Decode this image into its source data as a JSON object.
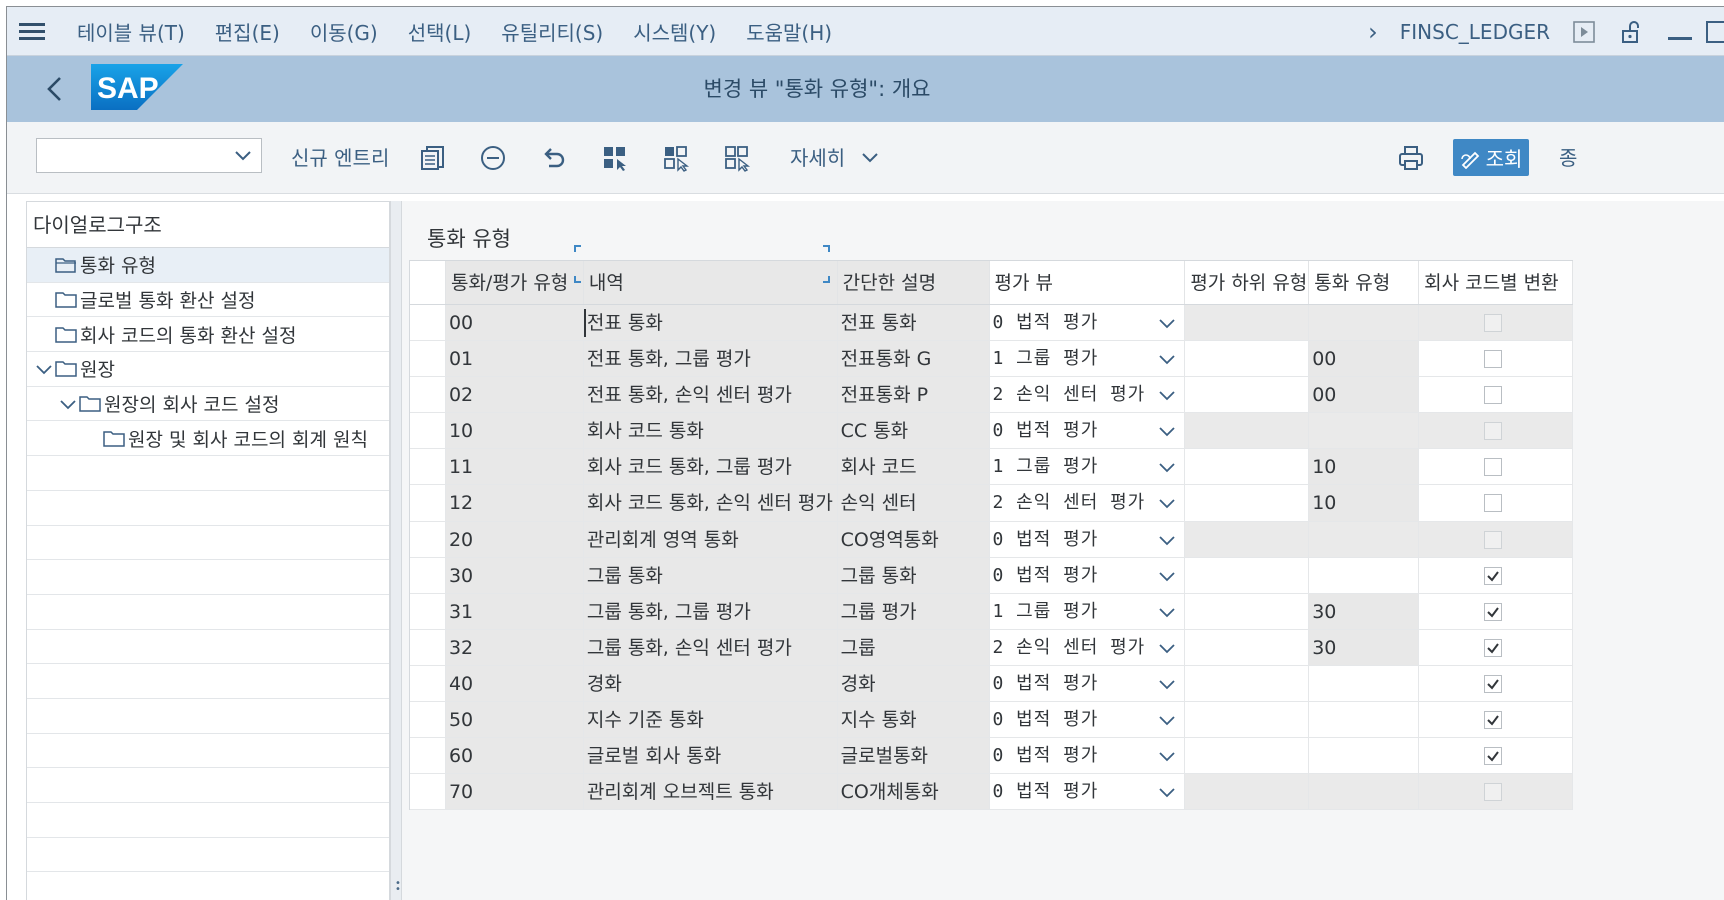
{
  "menubar": {
    "items": [
      "테이블 뷰(T)",
      "편집(E)",
      "이동(G)",
      "선택(L)",
      "유틸리티(S)",
      "시스템(Y)",
      "도움말(H)"
    ],
    "system_name": "FINSC_LEDGER"
  },
  "titlebar": {
    "title": "변경 뷰 \"통화 유형\": 개요",
    "logo_text": "SAP"
  },
  "toolbar": {
    "command_field_value": "",
    "new_entries_label": "신규 엔트리",
    "details_label": "자세히",
    "display_label": "조회",
    "cut_off_label": "종"
  },
  "left_panel": {
    "header": "다이얼로그구조",
    "items": [
      {
        "label": "통화 유형",
        "indent": 0,
        "expanded": null,
        "selected": true
      },
      {
        "label": "글로벌 통화 환산 설정",
        "indent": 0,
        "expanded": null,
        "selected": false
      },
      {
        "label": "회사 코드의 통화 환산 설정",
        "indent": 0,
        "expanded": null,
        "selected": false
      },
      {
        "label": "원장",
        "indent": 0,
        "expanded": true,
        "selected": false
      },
      {
        "label": "원장의 회사 코드 설정",
        "indent": 1,
        "expanded": true,
        "selected": false
      },
      {
        "label": "원장 및 회사 코드의 회계 원칙",
        "indent": 2,
        "expanded": null,
        "selected": false
      }
    ]
  },
  "main": {
    "section_title": "통화 유형",
    "columns": [
      "통화/평가 유형",
      "내역",
      "간단한 설명",
      "평가 뷰",
      "평가 하위 유형",
      "통화 유형",
      "회사 코드별 변환"
    ],
    "rows": [
      {
        "type": "00",
        "desc": "전표 통화",
        "short": "전표 통화",
        "view": "0 법적 평가",
        "subtype": "",
        "curtype": "",
        "convert": false,
        "enabled": false
      },
      {
        "type": "01",
        "desc": "전표 통화, 그룹 평가",
        "short": "전표통화 G",
        "view": "1 그룹 평가",
        "subtype": "",
        "curtype": "00",
        "convert": false,
        "enabled": true
      },
      {
        "type": "02",
        "desc": "전표 통화, 손익 센터 평가",
        "short": "전표통화 P",
        "view": "2 손익 센터 평가",
        "subtype": "",
        "curtype": "00",
        "convert": false,
        "enabled": true
      },
      {
        "type": "10",
        "desc": "회사 코드 통화",
        "short": "CC 통화",
        "view": "0 법적 평가",
        "subtype": "",
        "curtype": "",
        "convert": false,
        "enabled": false
      },
      {
        "type": "11",
        "desc": "회사 코드 통화, 그룹 평가",
        "short": "회사 코드",
        "view": "1 그룹 평가",
        "subtype": "",
        "curtype": "10",
        "convert": false,
        "enabled": true
      },
      {
        "type": "12",
        "desc": "회사 코드 통화, 손익 센터 평가",
        "short": "손익 센터",
        "view": "2 손익 센터 평가",
        "subtype": "",
        "curtype": "10",
        "convert": false,
        "enabled": true
      },
      {
        "type": "20",
        "desc": "관리회계 영역 통화",
        "short": "CO영역통화",
        "view": "0 법적 평가",
        "subtype": "",
        "curtype": "",
        "convert": false,
        "enabled": false
      },
      {
        "type": "30",
        "desc": "그룹 통화",
        "short": "그룹 통화",
        "view": "0 법적 평가",
        "subtype": "",
        "curtype": "",
        "convert": true,
        "enabled": true
      },
      {
        "type": "31",
        "desc": "그룹 통화, 그룹 평가",
        "short": "그룹 평가",
        "view": "1 그룹 평가",
        "subtype": "",
        "curtype": "30",
        "convert": true,
        "enabled": true
      },
      {
        "type": "32",
        "desc": "그룹 통화, 손익 센터 평가",
        "short": "그룹",
        "view": "2 손익 센터 평가",
        "subtype": "",
        "curtype": "30",
        "convert": true,
        "enabled": true
      },
      {
        "type": "40",
        "desc": "경화",
        "short": "경화",
        "view": "0 법적 평가",
        "subtype": "",
        "curtype": "",
        "convert": true,
        "enabled": true
      },
      {
        "type": "50",
        "desc": "지수 기준 통화",
        "short": "지수 통화",
        "view": "0 법적 평가",
        "subtype": "",
        "curtype": "",
        "convert": true,
        "enabled": true
      },
      {
        "type": "60",
        "desc": "글로벌 회사 통화",
        "short": "글로벌통화",
        "view": "0 법적 평가",
        "subtype": "",
        "curtype": "",
        "convert": true,
        "enabled": true
      },
      {
        "type": "70",
        "desc": "관리회계 오브젝트 통화",
        "short": "CO개체통화",
        "view": "0 법적 평가",
        "subtype": "",
        "curtype": "",
        "convert": false,
        "enabled": false
      }
    ]
  },
  "colors": {
    "menubar_bg": "#e6edf5",
    "titlebar_bg": "#a9c3dc",
    "accent": "#3f88c5",
    "text_link": "#3b5f82"
  }
}
